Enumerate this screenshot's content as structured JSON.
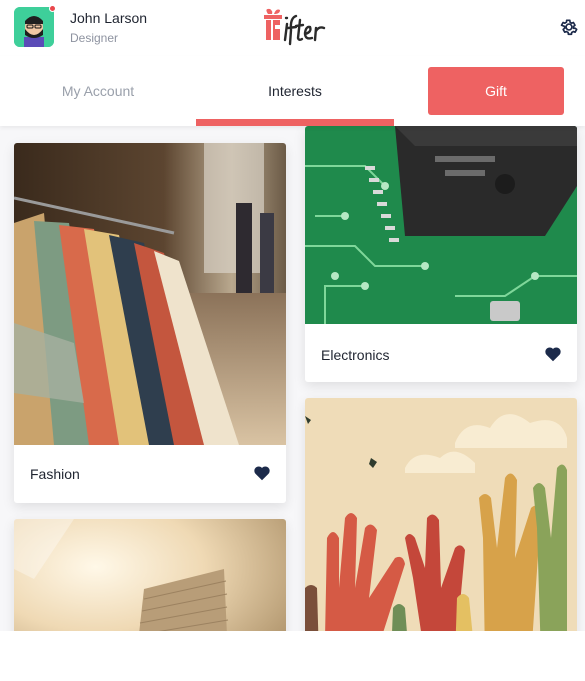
{
  "user": {
    "name": "John Larson",
    "role": "Designer"
  },
  "tabs": [
    {
      "label": "My Account"
    },
    {
      "label": "Interests"
    }
  ],
  "gift_button": {
    "label": "Gift"
  },
  "interests": [
    {
      "label": "Fashion"
    },
    {
      "label": "Electronics"
    }
  ],
  "colors": {
    "accent": "#ee6262",
    "heart": "#1c2a4a",
    "avatar_bg": "#3ecf9a"
  }
}
